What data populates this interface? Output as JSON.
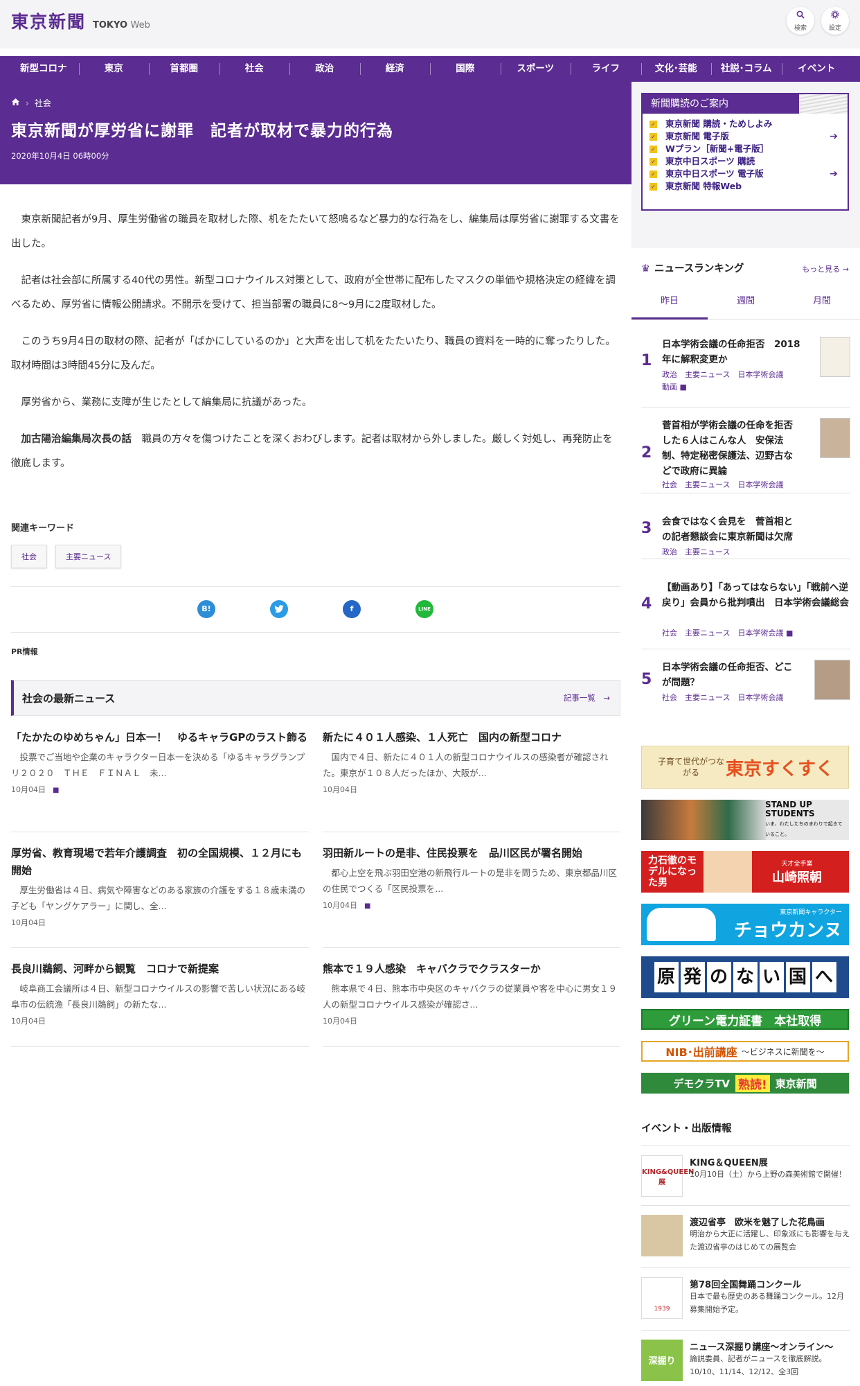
{
  "header": {
    "logo": "東京新聞",
    "logo_sub": "TOKYO",
    "logo_web": "Web",
    "search_label": "検索",
    "settings_label": "設定",
    "search_icon": "search-icon",
    "settings_icon": "gear-icon"
  },
  "nav": {
    "items": [
      "新型コロナ",
      "東京",
      "首都圏",
      "社会",
      "政治",
      "経済",
      "国際",
      "スポーツ",
      "ライフ",
      "文化･芸能",
      "社説･コラム",
      "イベント"
    ]
  },
  "article": {
    "breadcrumb": [
      "社会"
    ],
    "title": "東京新聞が厚労省に謝罪　記者が取材で暴力的行為",
    "date": "2020年10月4日 06時00分",
    "paragraphs": [
      "東京新聞記者が9月、厚生労働省の職員を取材した際、机をたたいて怒鳴るなど暴力的な行為をし、編集局は厚労省に謝罪する文書を出した。",
      "記者は社会部に所属する40代の男性。新型コロナウイルス対策として、政府が全世帯に配布したマスクの単価や規格決定の経緯を調べるため、厚労省に情報公開請求。不開示を受けて、担当部署の職員に8～9月に2度取材した。",
      "このうち9月4日の取材の際、記者が「ばかにしているのか」と大声を出して机をたたいたり、職員の資料を一時的に奪ったりした。取材時間は3時間45分に及んだ。",
      "厚労省から、業務に支障が生じたとして編集局に抗議があった。"
    ],
    "apology_label": "加古陽治編集局次長の話",
    "apology_text": "職員の方々を傷つけたことを深くおわびします。記者は取材から外しました。厳しく対処し、再発防止を徹底します。",
    "keywords_title": "関連キーワード",
    "keywords": [
      "社会",
      "主要ニュース"
    ],
    "share": {
      "hatena": "B!",
      "twitter": "twitter-icon",
      "facebook": "facebook-icon",
      "line": "LINE"
    },
    "pr_label": "PR情報"
  },
  "latest": {
    "title": "社会の最新ニュース",
    "more": "記事一覧",
    "items": [
      {
        "title": "「たかたのゆめちゃん」日本一！　ゆるキャラGPのラスト飾る",
        "text": "投票でご当地や企業のキャラクター日本一を決める「ゆるキャラグランプリ２０２０　ＴＨＥ　ＦＩＮＡＬ　未...",
        "date": "10月04日",
        "photo": true
      },
      {
        "title": "新たに４０１人感染、１人死亡　国内の新型コロナ",
        "text": "国内で４日、新たに４０１人の新型コロナウイルスの感染者が確認された。東京が１０８人だったほか、大阪が...",
        "date": "10月04日",
        "photo": false
      },
      {
        "title": "厚労省、教育現場で若年介護調査　初の全国規模、１２月にも開始",
        "text": "厚生労働省は４日、病気や障害などのある家族の介護をする１８歳未満の子ども「ヤングケアラー」に関し、全...",
        "date": "10月04日",
        "photo": false
      },
      {
        "title": "羽田新ルートの是非、住民投票を　品川区民が署名開始",
        "text": "都心上空を飛ぶ羽田空港の新飛行ルートの是非を問うため、東京都品川区の住民でつくる「区民投票を...",
        "date": "10月04日",
        "photo": true
      },
      {
        "title": "長良川鵜飼、河畔から観覧　コロナで新提案",
        "text": "岐阜商工会議所は４日、新型コロナウイルスの影響で苦しい状況にある岐阜市の伝統漁「長良川鵜飼」の新たな...",
        "date": "10月04日",
        "photo": false
      },
      {
        "title": "熊本で１９人感染　キャバクラでクラスターか",
        "text": "熊本県で４日、熊本市中央区のキャバクラの従業員や客を中心に男女１９人の新型コロナウイルス感染が確認さ...",
        "date": "10月04日",
        "photo": false
      }
    ]
  },
  "sidebar": {
    "subscribe": {
      "title": "新聞購読のご案内",
      "items": [
        "東京新聞 購読・ためしよみ",
        "東京新聞 電子版",
        "Wプラン［新聞+電子版］",
        "東京中日スポーツ 購読",
        "東京中日スポーツ 電子版",
        "東京新聞 特報Web"
      ]
    },
    "ranking": {
      "title": "ニュースランキング",
      "more": "もっと見る",
      "tabs": [
        "昨日",
        "週間",
        "月間"
      ],
      "items": [
        {
          "rank": "1",
          "title": "日本学術会議の任命拒否　2018年に解釈変更か",
          "tags": "政治　主要ニュース　日本学術会議",
          "tags2": "動画"
        },
        {
          "rank": "2",
          "title": "菅首相が学術会議の任命を拒否した６人はこんな人　安保法制、特定秘密保護法、辺野古などで政府に異論",
          "tags": "社会　主要ニュース　日本学術会議",
          "tags2": ""
        },
        {
          "rank": "3",
          "title": "会食ではなく会見を　菅首相との記者懇談会に東京新聞は欠席",
          "tags": "政治　主要ニュース",
          "tags2": ""
        },
        {
          "rank": "4",
          "title": "【動画あり】「あってはならない」「戦前へ逆戻り」会員から批判噴出　日本学術会議総会",
          "tags": "社会　主要ニュース　日本学術会議",
          "tags2": ""
        },
        {
          "rank": "5",
          "title": "日本学術会議の任命拒否、どこが問題？",
          "tags": "社会　主要ニュース　日本学術会議",
          "tags2": ""
        }
      ]
    },
    "banners": {
      "sukusuku_small": "子育て世代がつながる",
      "sukusuku_big": "東京すくすく",
      "students_big": "STAND UP STUDENTS",
      "students_small": "いま、わたしたちのまわりで起きていること。",
      "rikishi_left": "力石徹のモデルになった男",
      "rikishi_small": "天才全手業",
      "rikishi_name": "山崎照朝",
      "choukantu_small": "東京新聞キャラクター",
      "choukantu_big": "チョウカンヌ",
      "genpatsu": [
        "原",
        "発",
        "の",
        "な",
        "い",
        "国",
        "へ"
      ],
      "green": "グリーン電力証書　本社取得",
      "nib_big": "NIB･出前講座",
      "nib_small": "～ビジネスに新聞を～",
      "democra_left": "デモクラTV",
      "democra_mid": "熟読!",
      "democra_right": "東京新聞"
    },
    "events": {
      "title": "イベント・出版情報",
      "items": [
        {
          "title": "KING＆QUEEN展",
          "text": "10月10日（土）から上野の森美術館で開催！",
          "img": "KING&QUEEN展"
        },
        {
          "title": "渡辺省亭　欧米を魅了した花鳥画",
          "text": "明治から大正に活躍し、印象派にも影響を与えた渡辺省亭のはじめての展覧会",
          "img": ""
        },
        {
          "title": "第78回全国舞踊コンクール",
          "text": "日本で最も歴史のある舞踊コンクール。12月募集開始予定。",
          "img": "1939"
        },
        {
          "title": "ニュース深掘り講座～オンライン～",
          "text": "論説委員、記者がニュースを徹底解説。10/10、11/14、12/12、全3回",
          "img": "深掘り"
        }
      ]
    }
  },
  "colors": {
    "brand": "#5b2c91",
    "accent_yellow": "#f0c419",
    "hatena": "#2d8dd6",
    "twitter": "#2b9be6",
    "facebook": "#2467c6",
    "line": "#22b83a"
  }
}
